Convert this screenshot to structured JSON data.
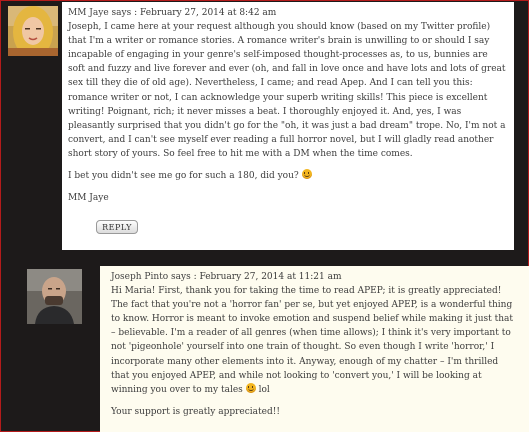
{
  "comments": [
    {
      "author": "MM Jaye",
      "says": " says : ",
      "date": "February 27, 2014 at 8:42 am",
      "p1": "Joseph, I came here at your request although you should know (based on my Twitter profile) that I'm a writer or romance stories. A romance writer's brain is unwilling to or should I say incapable of engaging in your genre's self-imposed thought-processes as, to us, bunnies are soft and fuzzy and live forever and ever (oh, and fall in love once and have lots and lots of great sex till they die of old age). Nevertheless, I came; and read Apep. And I can tell you this: romance writer or not, I can acknowledge your superb writing skills! This piece is excellent writing! Poignant, rich; it never misses a beat. I thoroughly enjoyed it. And, yes, I was pleasantly surprised that you didn't go for the \"oh, it was just a bad dream\" trope. No, I'm not a convert, and I can't see myself ever reading a full horror novel, but I will gladly read another short story of yours. So feel free to hit me with a DM when the time comes.",
      "p2": "I bet you didn't see me go for such a 180, did you?",
      "p3": "MM Jaye",
      "reply_label": "REPLY"
    },
    {
      "author": "Joseph Pinto",
      "says": " says : ",
      "date": "February 27, 2014 at 11:21 am",
      "p1a": "Hi Maria! First, thank you for taking the time to read APEP; it is greatly appreciated! The fact that you're not a 'horror fan' per se, but yet enjoyed APEP, is a wonderful thing to know. Horror is meant to invoke emotion and suspend belief while making it just that – believable. I'm a reader of all genres (when time allows); I think it's very important to not 'pigeonhole' yourself into one train of thought. So even though I write 'horror,' I incorporate many other elements into it. Anyway, enough of my chatter – I'm thrilled that you enjoyed APEP, and while not looking to 'convert you,' I will be looking at winning you over to my tales",
      "p1b": "lol",
      "p2": "Your support is greatly appreciated!!"
    }
  ],
  "icons": {
    "smiley": "smiley-icon",
    "avatar1": "avatar-blonde-woman",
    "avatar2": "avatar-bald-man"
  },
  "colors": {
    "page_bg": "#1d1a1a",
    "frame": "#b41b1b",
    "comment1_bg": "#ffffff",
    "comment2_bg": "#fefcef"
  }
}
